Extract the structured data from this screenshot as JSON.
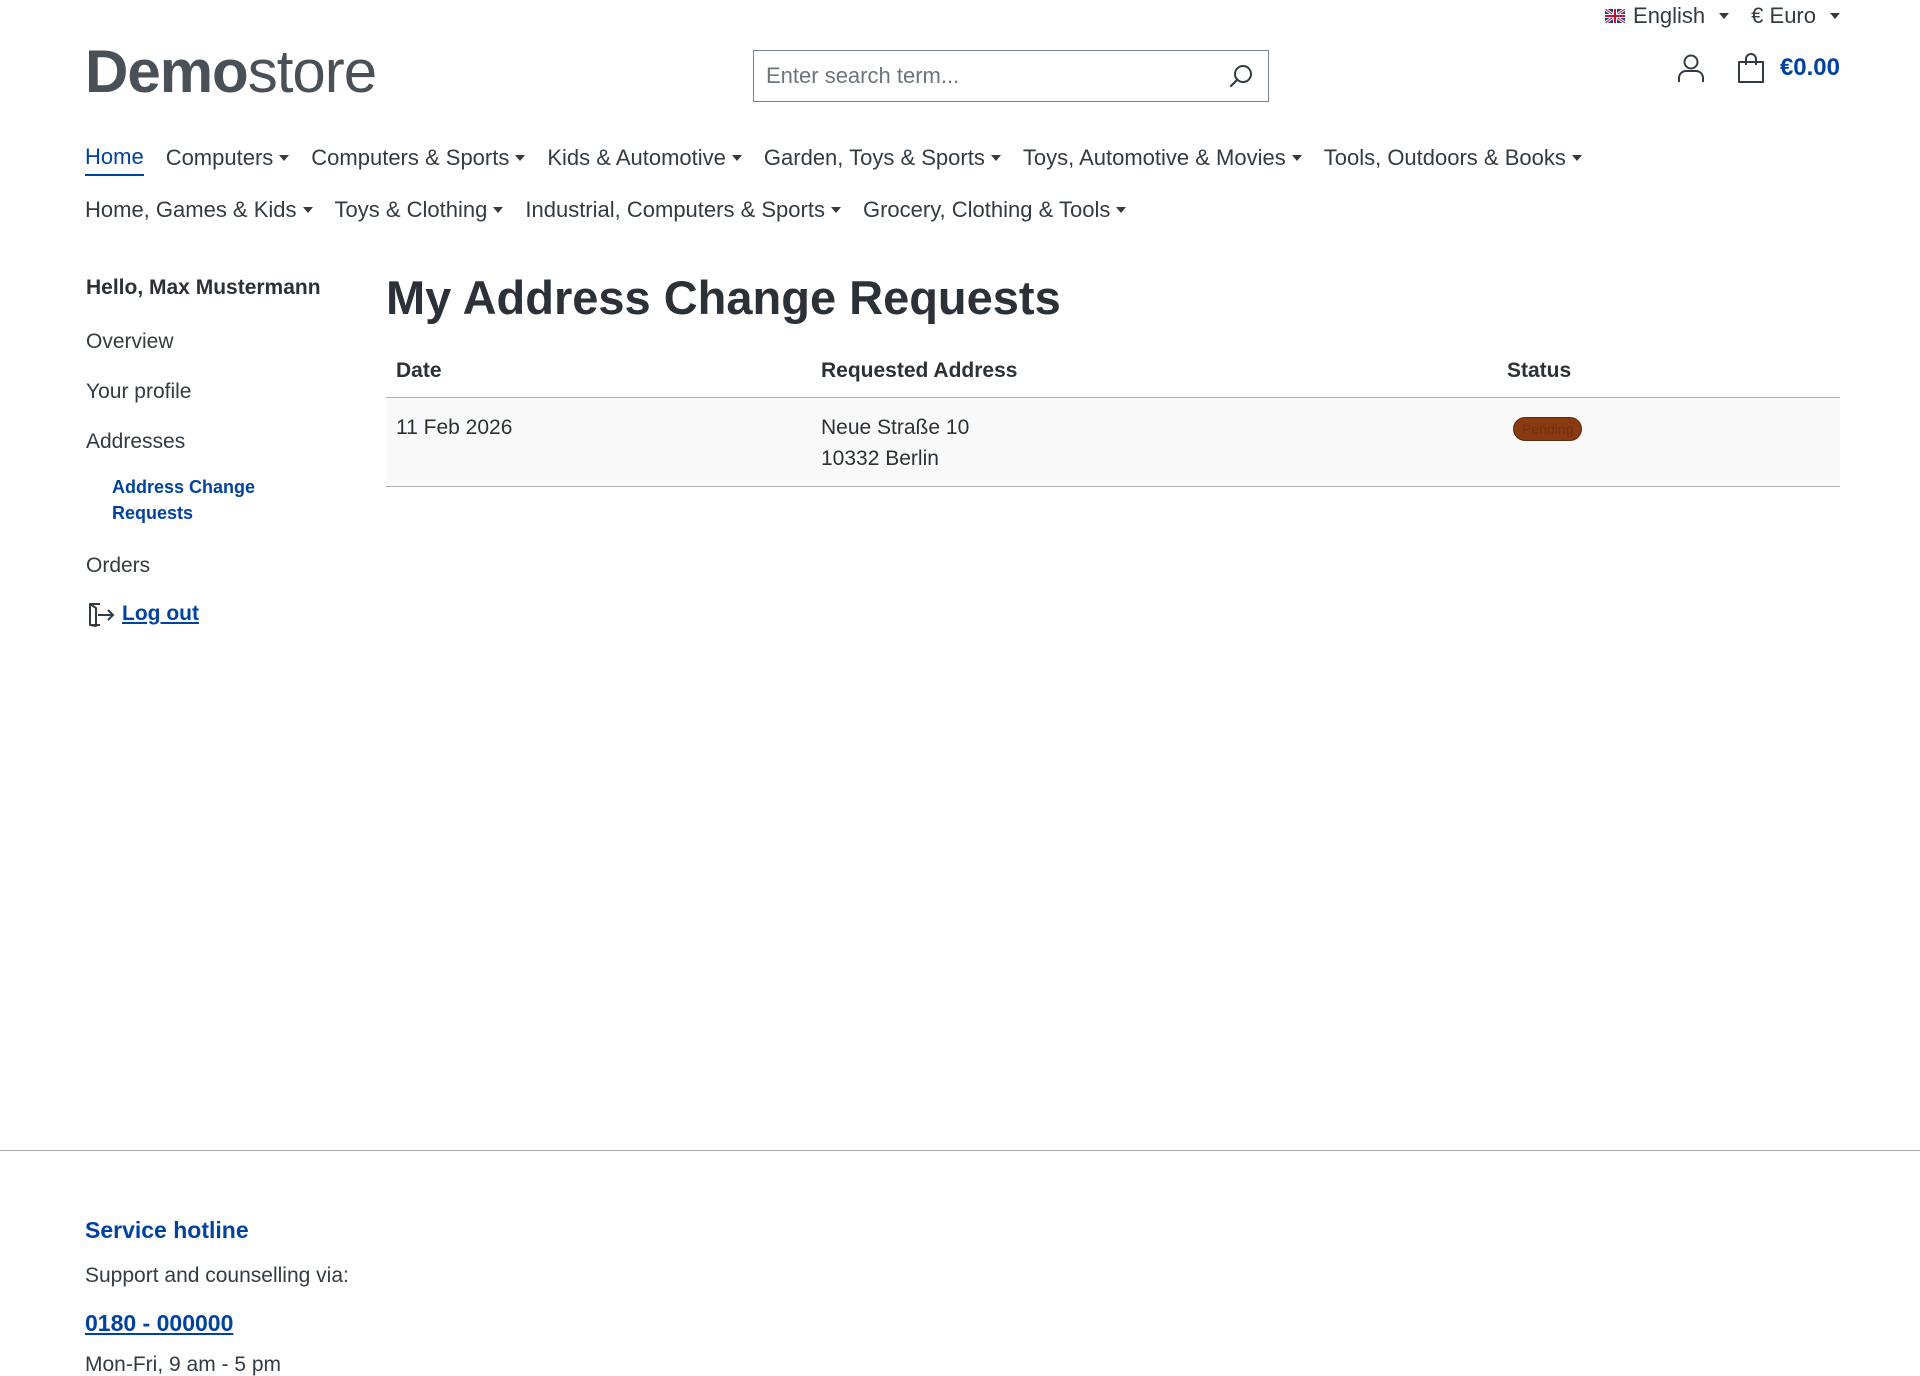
{
  "topbar": {
    "language": "English",
    "currency": "€ Euro"
  },
  "header": {
    "logo_bold": "Demo",
    "logo_light": "store",
    "search_placeholder": "Enter search term...",
    "cart_total": "€0.00"
  },
  "nav": {
    "row1": [
      {
        "label": "Home",
        "dropdown": false,
        "active": true
      },
      {
        "label": "Computers",
        "dropdown": true
      },
      {
        "label": "Computers & Sports",
        "dropdown": true
      },
      {
        "label": "Kids & Automotive",
        "dropdown": true
      },
      {
        "label": "Garden, Toys & Sports",
        "dropdown": true
      },
      {
        "label": "Toys, Automotive & Movies",
        "dropdown": true
      },
      {
        "label": "Tools, Outdoors & Books",
        "dropdown": true
      }
    ],
    "row2": [
      {
        "label": "Home, Games & Kids",
        "dropdown": true
      },
      {
        "label": "Toys & Clothing",
        "dropdown": true
      },
      {
        "label": "Industrial, Computers & Sports",
        "dropdown": true
      },
      {
        "label": "Grocery, Clothing & Tools",
        "dropdown": true
      }
    ]
  },
  "sidebar": {
    "greeting": "Hello, Max Mustermann",
    "items": [
      "Overview",
      "Your profile",
      "Addresses"
    ],
    "sub_item": "Address Change Requests",
    "orders": "Orders",
    "logout": "Log out"
  },
  "main": {
    "title": "My Address Change Requests",
    "columns": [
      "Date",
      "Requested Address",
      "Status"
    ],
    "rows": [
      {
        "date": "11 Feb 2026",
        "address_line1": "Neue Straße 10",
        "address_line2": "10332 Berlin",
        "status": "Pending"
      }
    ]
  },
  "footer": {
    "title": "Service hotline",
    "text": "Support and counselling via:",
    "phone": "0180 - 000000",
    "hours": "Mon-Fri, 9 am - 5 pm"
  },
  "colors": {
    "accent": "#0042a0",
    "badge_bg": "#8a3a10"
  }
}
